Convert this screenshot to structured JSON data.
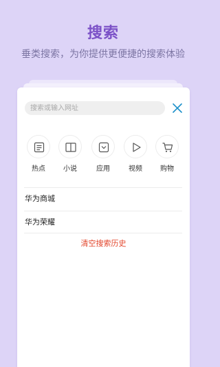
{
  "hero": {
    "title": "搜索",
    "subtitle": "垂类搜索，为你提供更便捷的搜索体验"
  },
  "search": {
    "placeholder": "搜索或输入网址"
  },
  "icons": {
    "close": "close-icon"
  },
  "categories": [
    {
      "label": "热点",
      "icon": "news-icon"
    },
    {
      "label": "小说",
      "icon": "book-icon"
    },
    {
      "label": "应用",
      "icon": "app-store-icon"
    },
    {
      "label": "视频",
      "icon": "play-icon"
    },
    {
      "label": "购物",
      "icon": "cart-icon"
    }
  ],
  "history": {
    "items": [
      "华为商城",
      "华为荣耀"
    ],
    "clear_label": "清空搜索历史"
  },
  "colors": {
    "background": "#ddd4f7",
    "title": "#7b51c7",
    "accent": "#1a8fc9",
    "clear": "#e2442a"
  }
}
